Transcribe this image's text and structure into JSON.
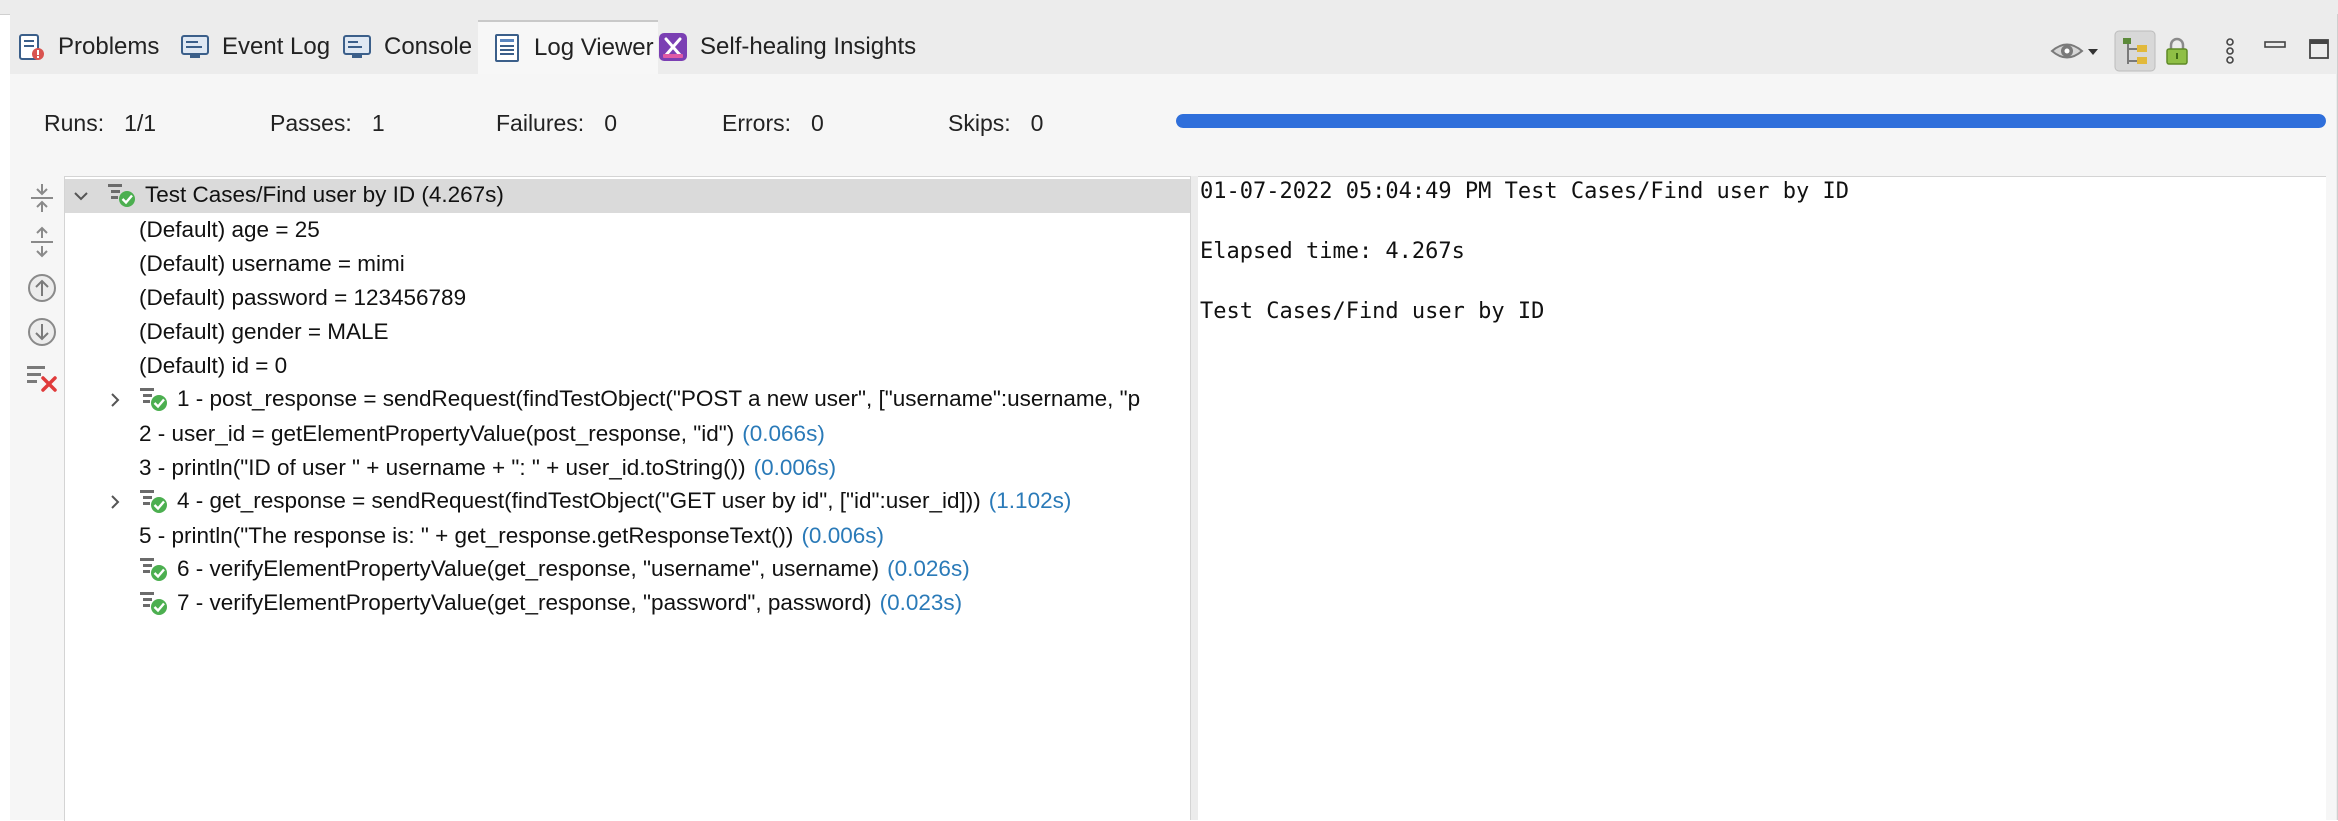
{
  "tabs": [
    {
      "label": "Problems",
      "icon": "problems-icon"
    },
    {
      "label": "Event Log",
      "icon": "event-log-icon"
    },
    {
      "label": "Console",
      "icon": "console-icon"
    },
    {
      "label": "Log Viewer",
      "icon": "log-viewer-icon",
      "active": true
    },
    {
      "label": "Self-healing Insights",
      "icon": "self-healing-icon"
    }
  ],
  "toolbar_icons": [
    "eye-icon",
    "dropdown-caret-icon",
    "tree-view-icon",
    "lock-icon",
    "more-options-icon",
    "minimize-icon",
    "maximize-icon"
  ],
  "summary": {
    "runs_label": "Runs:",
    "runs_value": "1/1",
    "passes_label": "Passes:",
    "passes_value": "1",
    "failures_label": "Failures:",
    "failures_value": "0",
    "errors_label": "Errors:",
    "errors_value": "0",
    "skips_label": "Skips:",
    "skips_value": "0",
    "progress": 1.0,
    "progress_color": "#2f6fdb"
  },
  "side_toolbar_icons": [
    "collapse-all-icon",
    "expand-all-icon",
    "previous-failure-icon",
    "next-failure-icon",
    "clear-log-icon"
  ],
  "tree": {
    "root": {
      "text": "Test Cases/Find user by ID (4.267s)"
    },
    "variables": [
      "(Default) age = 25",
      "(Default) username = mimi",
      "(Default) password = 123456789",
      "(Default) gender = MALE",
      "(Default) id = 0"
    ],
    "steps": [
      {
        "text": "1 - post_response = sendRequest(findTestObject(\"POST a new user\", [\"username\":username, \"p",
        "duration": "",
        "icon": true,
        "expandable": true
      },
      {
        "text": "2 - user_id = getElementPropertyValue(post_response, \"id\")",
        "duration": "(0.066s)",
        "icon": false,
        "expandable": false
      },
      {
        "text": "3 - println(\"ID of user \" + username + \": \" + user_id.toString())",
        "duration": "(0.006s)",
        "icon": false,
        "expandable": false
      },
      {
        "text": "4 - get_response = sendRequest(findTestObject(\"GET user by id\", [\"id\":user_id]))",
        "duration": "(1.102s)",
        "icon": true,
        "expandable": true
      },
      {
        "text": "5 - println(\"The response is: \" + get_response.getResponseText())",
        "duration": "(0.006s)",
        "icon": false,
        "expandable": false
      },
      {
        "text": "6 - verifyElementPropertyValue(get_response, \"username\", username)",
        "duration": "(0.026s)",
        "icon": true,
        "expandable": false
      },
      {
        "text": "7 - verifyElementPropertyValue(get_response, \"password\", password)",
        "duration": "(0.023s)",
        "icon": true,
        "expandable": false
      }
    ]
  },
  "detail": {
    "line1": "01-07-2022 05:04:49 PM Test Cases/Find user by ID",
    "line2": "Elapsed time: 4.267s",
    "line3": "Test Cases/Find user by ID"
  },
  "colors": {
    "duration_text": "#2a7ab8",
    "pass_green": "#4caf50",
    "selected_row": "#dadada"
  }
}
